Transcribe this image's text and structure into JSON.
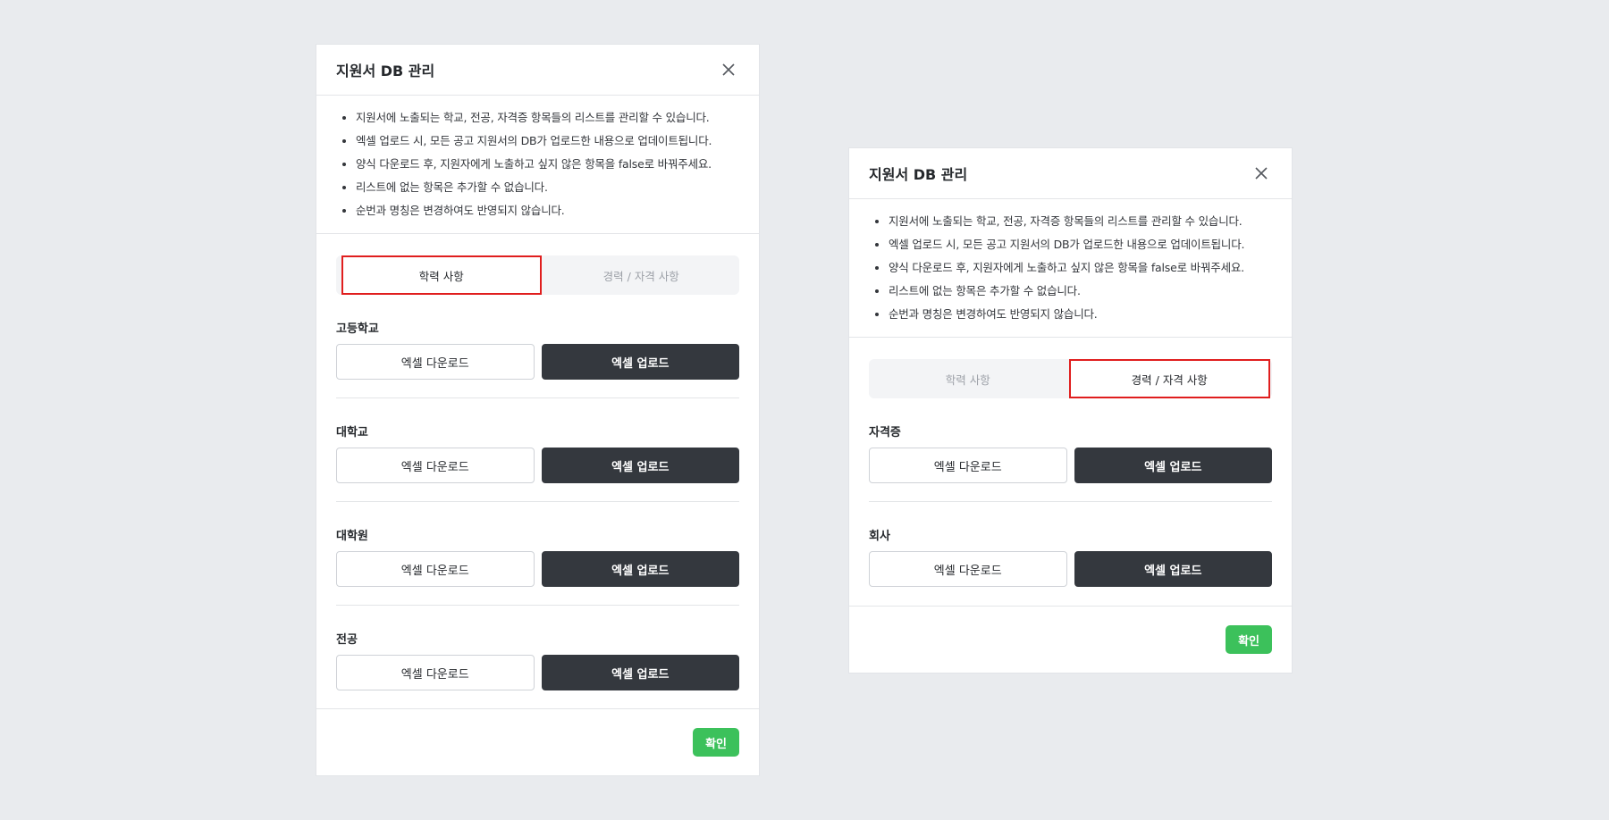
{
  "colors": {
    "background": "#e9ebee",
    "dark_button": "#34383e",
    "confirm_button": "#3cc15b",
    "highlight_border": "#e01e1e"
  },
  "modal_left": {
    "title": "지원서 DB 관리",
    "close_icon": "close-icon",
    "notices": [
      "지원서에 노출되는 학교, 전공, 자격증 항목들의 리스트를 관리할 수 있습니다.",
      "엑셀 업로드 시, 모든 공고 지원서의 DB가 업로드한 내용으로 업데이트됩니다.",
      "양식 다운로드 후, 지원자에게 노출하고 싶지 않은 항목을 false로 바꿔주세요.",
      "리스트에 없는 항목은 추가할 수 없습니다.",
      "순번과 명칭은 변경하여도 반영되지 않습니다."
    ],
    "tabs": [
      {
        "label": "학력 사항",
        "active": true
      },
      {
        "label": "경력 / 자격 사항",
        "active": false
      }
    ],
    "sections": [
      {
        "label": "고등학교",
        "download": "엑셀 다운로드",
        "upload": "엑셀 업로드"
      },
      {
        "label": "대학교",
        "download": "엑셀 다운로드",
        "upload": "엑셀 업로드"
      },
      {
        "label": "대학원",
        "download": "엑셀 다운로드",
        "upload": "엑셀 업로드"
      },
      {
        "label": "전공",
        "download": "엑셀 다운로드",
        "upload": "엑셀 업로드"
      }
    ],
    "confirm_label": "확인"
  },
  "modal_right": {
    "title": "지원서 DB 관리",
    "close_icon": "close-icon",
    "notices": [
      "지원서에 노출되는 학교, 전공, 자격증 항목들의 리스트를 관리할 수 있습니다.",
      "엑셀 업로드 시, 모든 공고 지원서의 DB가 업로드한 내용으로 업데이트됩니다.",
      "양식 다운로드 후, 지원자에게 노출하고 싶지 않은 항목을 false로 바꿔주세요.",
      "리스트에 없는 항목은 추가할 수 없습니다.",
      "순번과 명칭은 변경하여도 반영되지 않습니다."
    ],
    "tabs": [
      {
        "label": "학력 사항",
        "active": false
      },
      {
        "label": "경력 / 자격 사항",
        "active": true
      }
    ],
    "sections": [
      {
        "label": "자격증",
        "download": "엑셀 다운로드",
        "upload": "엑셀 업로드"
      },
      {
        "label": "회사",
        "download": "엑셀 다운로드",
        "upload": "엑셀 업로드"
      }
    ],
    "confirm_label": "확인"
  }
}
